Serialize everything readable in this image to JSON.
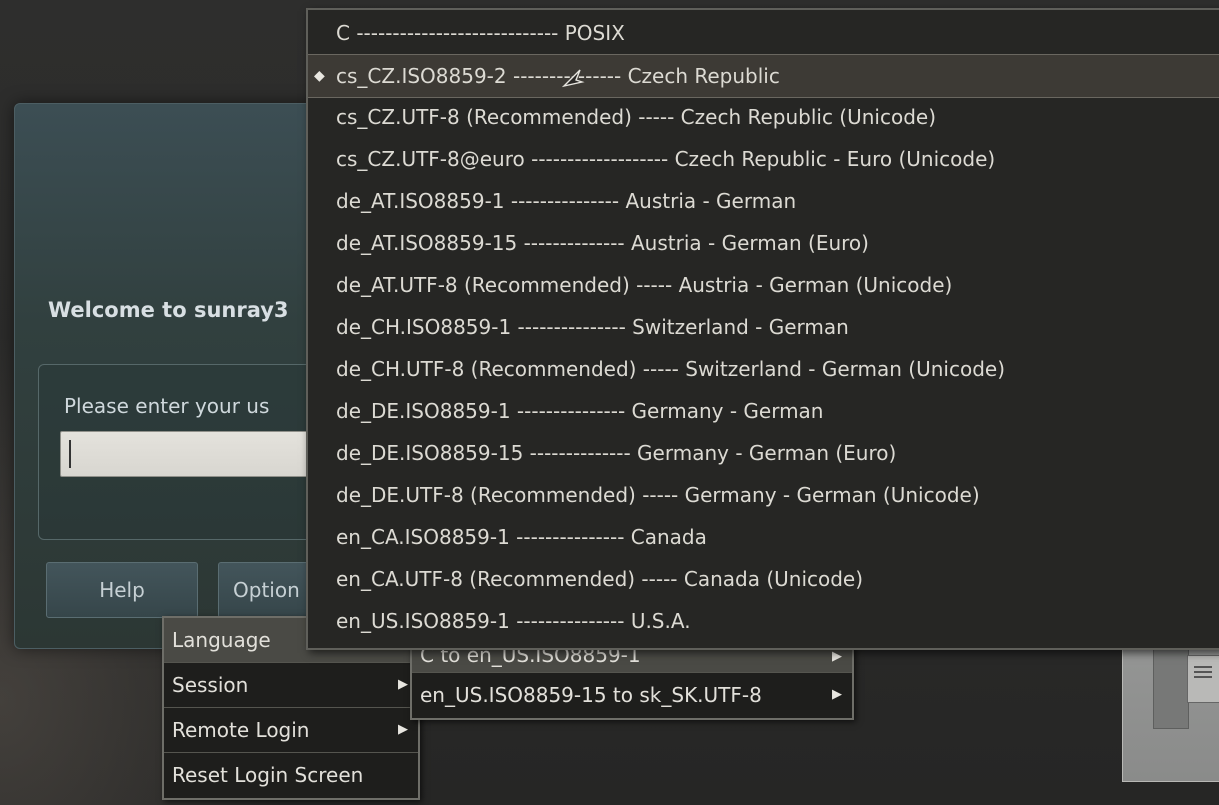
{
  "login": {
    "welcome": "Welcome to sunray3",
    "prompt": "Please enter your us",
    "help_button": "Help",
    "options_button": "Option"
  },
  "options_menu": {
    "items": [
      {
        "label": "Language",
        "has_submenu": false
      },
      {
        "label": "Session",
        "has_submenu": true
      },
      {
        "label": "Remote Login",
        "has_submenu": true
      },
      {
        "label": "Reset Login Screen",
        "has_submenu": false
      }
    ]
  },
  "language_submenu": {
    "items": [
      {
        "label": "C to en_US.ISO8859-1",
        "has_submenu": true
      },
      {
        "label": "en_US.ISO8859-15 to sk_SK.UTF-8",
        "has_submenu": true
      }
    ]
  },
  "locale_list": {
    "selected_index": 1,
    "items": [
      {
        "label": "C ---------------------------- POSIX"
      },
      {
        "label": "cs_CZ.ISO8859-2 --------------- Czech Republic"
      },
      {
        "label": "cs_CZ.UTF-8 (Recommended) ----- Czech Republic (Unicode)"
      },
      {
        "label": "cs_CZ.UTF-8@euro ------------------- Czech Republic - Euro (Unicode)"
      },
      {
        "label": "de_AT.ISO8859-1 --------------- Austria - German"
      },
      {
        "label": "de_AT.ISO8859-15 -------------- Austria - German (Euro)"
      },
      {
        "label": "de_AT.UTF-8 (Recommended) ----- Austria - German (Unicode)"
      },
      {
        "label": "de_CH.ISO8859-1 --------------- Switzerland - German"
      },
      {
        "label": "de_CH.UTF-8 (Recommended) ----- Switzerland - German (Unicode)"
      },
      {
        "label": "de_DE.ISO8859-1 --------------- Germany - German"
      },
      {
        "label": "de_DE.ISO8859-15 -------------- Germany - German (Euro)"
      },
      {
        "label": "de_DE.UTF-8 (Recommended) ----- Germany - German (Unicode)"
      },
      {
        "label": "en_CA.ISO8859-1 --------------- Canada"
      },
      {
        "label": "en_CA.UTF-8 (Recommended) ----- Canada (Unicode)"
      },
      {
        "label": "en_US.ISO8859-1 --------------- U.S.A."
      }
    ]
  },
  "icons": {
    "selected_marker": "diamond-icon",
    "submenu_arrow": "triangle-right-icon",
    "cursor": "arrow-pointer-icon"
  }
}
